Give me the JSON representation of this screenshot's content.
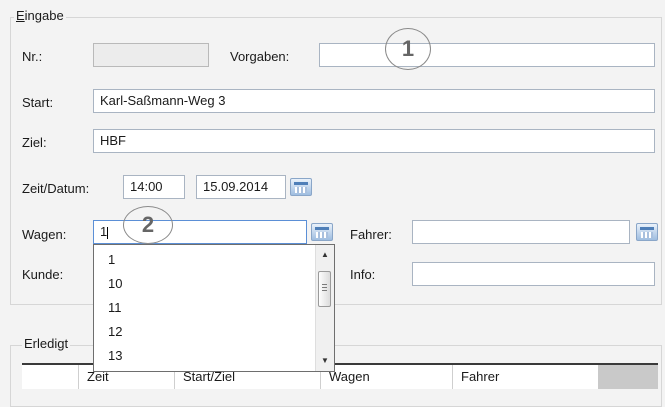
{
  "eingabe": {
    "title": "Eingabe",
    "nr_label": "Nr.:",
    "nr_value": "",
    "vorgaben_label": "Vorgaben:",
    "vorgaben_value": "",
    "start_label": "Start:",
    "start_value": "Karl-Saßmann-Weg 3",
    "ziel_label": "Ziel:",
    "ziel_value": "HBF",
    "zeit_label": "Zeit/Datum:",
    "zeit_value": "14:00",
    "datum_value": "15.09.2014",
    "wagen_label": "Wagen:",
    "wagen_value": "1",
    "fahrer_label": "Fahrer:",
    "fahrer_value": "",
    "kunde_label": "Kunde:",
    "info_label": "Info:",
    "info_value": ""
  },
  "callouts": {
    "one": "1",
    "two": "2"
  },
  "wagen_dropdown": {
    "items": [
      "1",
      "10",
      "11",
      "12",
      "13"
    ]
  },
  "erledigt": {
    "title": "Erledigt",
    "columns": [
      "Zeit",
      "Start/Ziel",
      "Wagen",
      "Fahrer"
    ]
  }
}
